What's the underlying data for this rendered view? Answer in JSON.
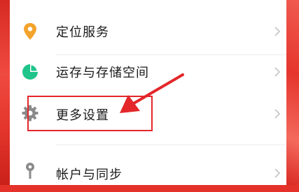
{
  "settings": {
    "items": [
      {
        "label": "定位服务",
        "icon": "location-pin-icon",
        "icon_color": "#f3a32b"
      },
      {
        "label": "运存与存储空间",
        "icon": "storage-pie-icon",
        "icon_color": "#1ec48a"
      },
      {
        "label": "更多设置",
        "icon": "gear-icon",
        "icon_color": "#8a8a8a"
      },
      {
        "label": "帐户与同步",
        "icon": "account-pin-icon",
        "icon_color": "#8a8a8a"
      }
    ]
  },
  "annotation": {
    "color": "#e3272a"
  },
  "background": {
    "color": "#e4322a"
  }
}
